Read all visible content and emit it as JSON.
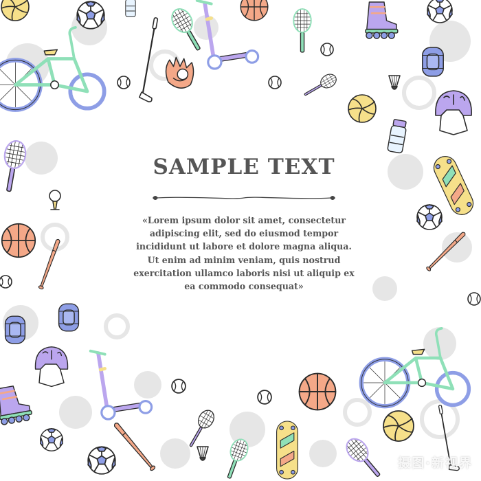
{
  "card": {
    "title": "SAMPLE TEXT",
    "body": "«Lorem ipsum dolor sit amet, consectetur adipiscing elit, sed do eiusmod tempor incididunt ut labore et dolore magna aliqua. Ut enim ad minim veniam, quis nostrud exercitation ullamco laboris nisi ut aliquip ex ea commodo consequat»"
  },
  "watermark": "摄图·新视界",
  "colors": {
    "text": "#555555",
    "mint": "#8fe0b8",
    "lavender": "#bba6ee",
    "blue": "#8e9ee6",
    "peach": "#f4a888",
    "yellow": "#f6e08a",
    "outline": "#2b2b2b",
    "ghost": "#e3e3e3"
  },
  "icons": [
    "bicycle-icon",
    "scooter-icon",
    "soccer-ball-icon",
    "basketball-icon",
    "volleyball-icon",
    "tennis-racket-icon",
    "badminton-racket-icon",
    "shuttlecock-icon",
    "baseball-bat-icon",
    "baseball-icon",
    "baseball-glove-icon",
    "golf-club-icon",
    "golf-ball-icon",
    "helmet-icon",
    "knee-pad-icon",
    "roller-skate-icon",
    "skateboard-icon",
    "water-bottle-icon"
  ]
}
